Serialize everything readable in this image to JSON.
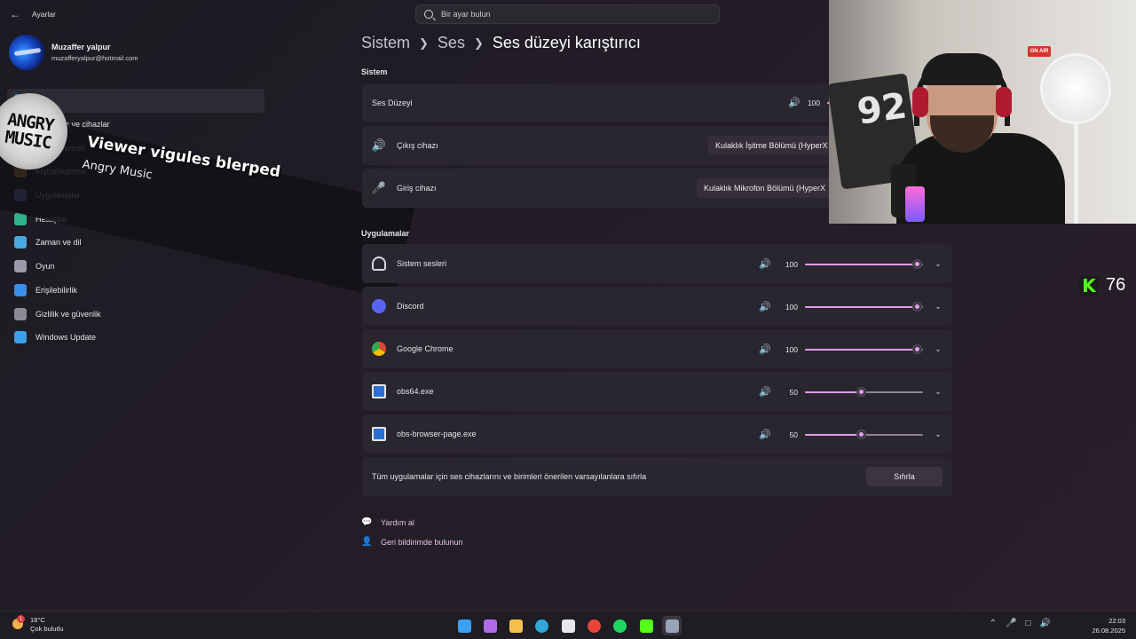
{
  "window": {
    "app_title": "Ayarlar",
    "search_placeholder": "Bir ayar bulun"
  },
  "user": {
    "name": "Muzaffer yalpur",
    "email": "muzafferyalpur@hotmail.com"
  },
  "sidebar": {
    "items": [
      {
        "label": "",
        "icon": "system-icon",
        "color": "#4a8fe0"
      },
      {
        "label": "Bluetooth ve cihazlar",
        "icon": "bluetooth-icon",
        "color": "#4a8fe0"
      },
      {
        "label": "Ağ ve internet",
        "icon": "network-icon",
        "color": "#5a9bd8"
      },
      {
        "label": "Kişiselleştirme",
        "icon": "brush-icon",
        "color": "#e0a040"
      },
      {
        "label": "Uygulamalar",
        "icon": "apps-icon",
        "color": "#6a8fd8"
      },
      {
        "label": "Hesaplar",
        "icon": "accounts-icon",
        "color": "#2fb38a"
      },
      {
        "label": "Zaman ve dil",
        "icon": "globe-clock-icon",
        "color": "#4aa8e0"
      },
      {
        "label": "Oyun",
        "icon": "gamepad-icon",
        "color": "#9a9aa8"
      },
      {
        "label": "Erişilebilirlik",
        "icon": "accessibility-icon",
        "color": "#3a8fe8"
      },
      {
        "label": "Gizlilik ve güvenlik",
        "icon": "shield-icon",
        "color": "#8a8a96"
      },
      {
        "label": "Windows Update",
        "icon": "update-icon",
        "color": "#3a9ee8"
      }
    ]
  },
  "overlay": {
    "disc_line1": "ANGRY",
    "disc_line2": "MUSIC",
    "title": "Viewer vigules blerped",
    "subtitle": "Angry Music"
  },
  "breadcrumb": {
    "items": [
      "Sistem",
      "Ses"
    ],
    "current": "Ses düzeyi karıştırıcı"
  },
  "system_section": {
    "title": "Sistem",
    "volume_label": "Ses Düzeyi",
    "volume_value": "100",
    "output_label": "Çıkış cihazı",
    "output_device": "Kulaklık İşitme Bölümü (HyperX",
    "input_label": "Giriş cihazı",
    "input_device": "Kulaklık Mikrofon Bölümü (HyperX"
  },
  "apps_section": {
    "title": "Uygulamalar",
    "apps": [
      {
        "name": "Sistem sesleri",
        "volume": "100",
        "level": 100,
        "icon": "headset-icon"
      },
      {
        "name": "Discord",
        "volume": "100",
        "level": 100,
        "icon": "discord-icon"
      },
      {
        "name": "Google Chrome",
        "volume": "100",
        "level": 100,
        "icon": "chrome-icon"
      },
      {
        "name": "obs64.exe",
        "volume": "50",
        "level": 50,
        "icon": "app-window-icon"
      },
      {
        "name": "obs-browser-page.exe",
        "volume": "50",
        "level": 50,
        "icon": "app-window-icon"
      }
    ],
    "reset_text": "Tüm uygulamalar için ses cihazlarını ve birimleri önerilen varsayılanlara sıfırla",
    "reset_button": "Sıfırla"
  },
  "links": {
    "help": "Yardım al",
    "feedback": "Geri bildirimde bulunun"
  },
  "webcam": {
    "sign": "ON AIR",
    "jersey": "92"
  },
  "kick_badge": {
    "logo": "K",
    "count": "76"
  },
  "taskbar": {
    "weather_temp": "18°C",
    "weather_desc": "Çok bulutlu",
    "weather_badge": "1",
    "time": "22:03",
    "date": "26.08.2025",
    "apps": [
      {
        "name": "windows-start-icon",
        "color": "#3aa0f0"
      },
      {
        "name": "copilot-icon",
        "color": "#b06ae8"
      },
      {
        "name": "file-explorer-icon",
        "color": "#f2c14a"
      },
      {
        "name": "edge-icon",
        "color": "#2fa8d8"
      },
      {
        "name": "store-icon",
        "color": "#e8e8ea"
      },
      {
        "name": "chrome-icon",
        "color": "#e8443a"
      },
      {
        "name": "spotify-icon",
        "color": "#1ed760"
      },
      {
        "name": "kick-icon",
        "color": "#53fc18"
      },
      {
        "name": "settings-icon",
        "color": "#9aa4b8"
      }
    ]
  },
  "colors": {
    "accent": "#e09ce8",
    "card_bg": "#2a2630"
  }
}
